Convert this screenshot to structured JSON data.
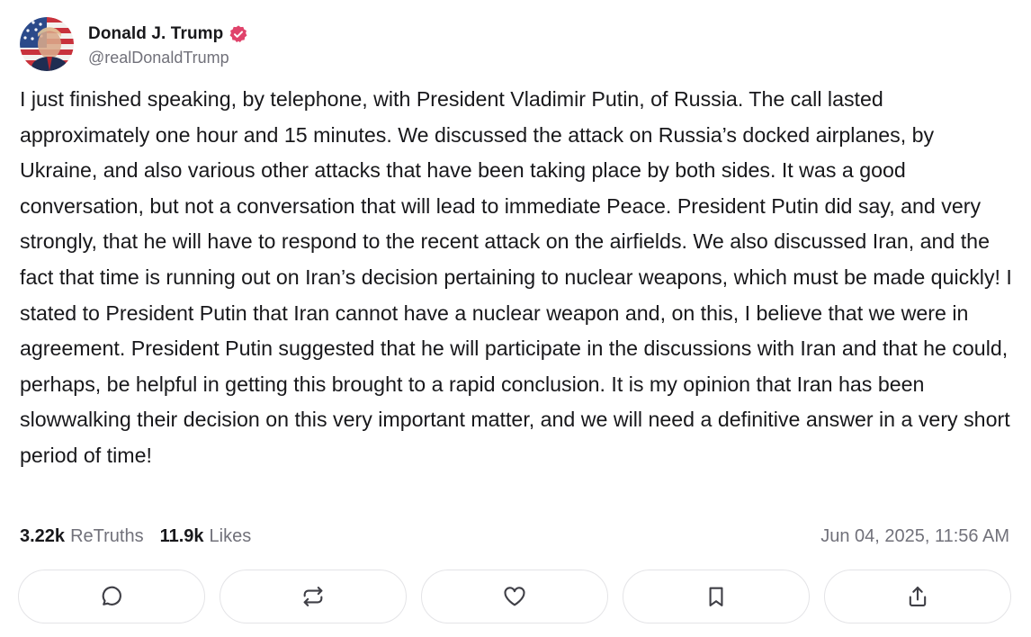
{
  "post": {
    "author": {
      "display_name": "Donald J. Trump",
      "handle": "@realDonaldTrump",
      "verified": true,
      "avatar_icon": "flag-portrait-avatar",
      "verified_color": "#e0436b"
    },
    "body": "I just finished speaking, by telephone, with President Vladimir Putin, of Russia. The call lasted approximately one hour and 15 minutes. We discussed the attack on Russia’s docked airplanes, by Ukraine, and also various other attacks that have been taking place by both sides. It was a good conversation, but not a conversation that will lead to immediate Peace. President Putin did say, and very strongly, that he will have to respond to the recent attack on the airfields. We also discussed Iran, and the fact that time is running out on Iran’s decision pertaining to nuclear weapons, which must be made quickly! I stated to President Putin that Iran cannot have a nuclear weapon and, on this, I believe that we were in agreement. President Putin suggested that he will participate in the discussions with Iran and that he could, perhaps, be helpful in getting this brought to a rapid conclusion. It is my opinion that Iran has been slowwalking their decision on this very important matter, and we will need a definitive answer in a very short period of time!",
    "stats": {
      "retruths_count": "3.22k",
      "retruths_label": "ReTruths",
      "likes_count": "11.9k",
      "likes_label": "Likes"
    },
    "timestamp": "Jun 04, 2025, 11:56 AM"
  },
  "actions": [
    {
      "name": "reply",
      "icon": "comment-icon"
    },
    {
      "name": "retruth",
      "icon": "repost-icon"
    },
    {
      "name": "like",
      "icon": "heart-icon"
    },
    {
      "name": "bookmark",
      "icon": "bookmark-icon"
    },
    {
      "name": "share",
      "icon": "share-icon"
    }
  ],
  "colors": {
    "text_primary": "#18181b",
    "text_secondary": "#71717a",
    "border": "#e4e4e7",
    "icon": "#3f3f46"
  }
}
